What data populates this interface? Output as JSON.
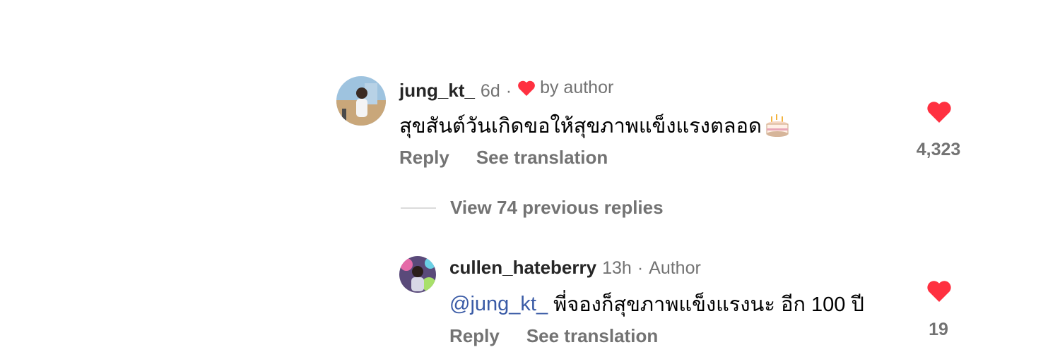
{
  "comments": [
    {
      "username": "jung_kt_",
      "time": "6d",
      "separator": "·",
      "liked_by": "by author",
      "text": "สุขสันต์วันเกิดขอให้สุขภาพแข็งแรงตลอด",
      "emoji": "birthday-cake-icon",
      "reply_label": "Reply",
      "translate_label": "See translation",
      "like_count": "4,323"
    }
  ],
  "view_replies_label": "View 74 previous replies",
  "replies": [
    {
      "username": "cullen_hateberry",
      "time": "13h",
      "separator": "·",
      "role": "Author",
      "mention": "@jung_kt_",
      "text": " พี่จองก็สุขภาพแข็งแรงนะ อีก 100 ปี",
      "reply_label": "Reply",
      "translate_label": "See translation",
      "like_count": "19"
    }
  ],
  "colors": {
    "heart": "#ff3040",
    "mention": "#3a5ba6",
    "muted": "#737373"
  }
}
